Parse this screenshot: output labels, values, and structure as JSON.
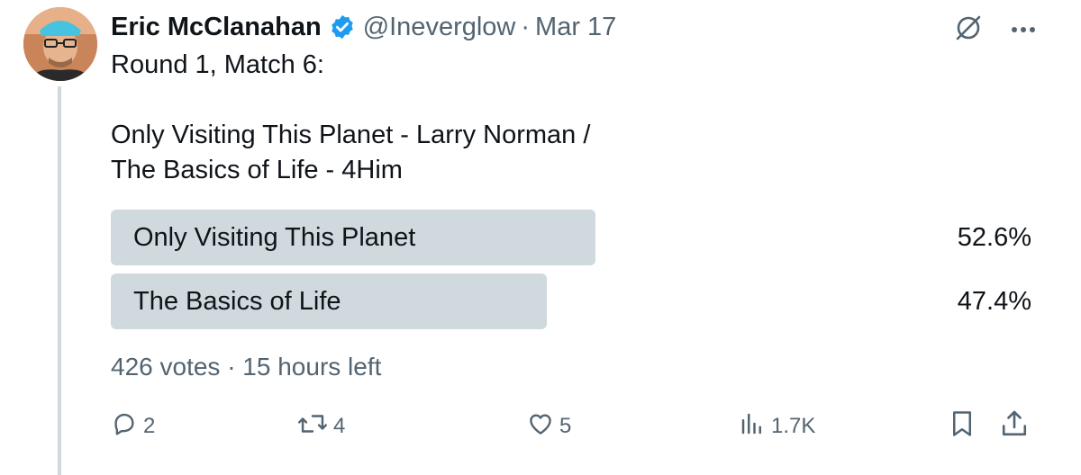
{
  "author": {
    "name": "Eric McClanahan",
    "handle": "@Ineverglow",
    "date": "Mar 17",
    "separator": "·"
  },
  "tweet": {
    "text": "Round 1, Match 6:\n\nOnly Visiting This Planet - Larry Norman /\nThe Basics of Life - 4Him"
  },
  "poll": {
    "options": [
      {
        "label": "Only Visiting This Planet",
        "percent_text": "52.6%",
        "fraction": 0.526
      },
      {
        "label": "The Basics of Life",
        "percent_text": "47.4%",
        "fraction": 0.474
      }
    ],
    "meta": "426 votes · 15 hours left"
  },
  "actions": {
    "replies": "2",
    "retweets": "4",
    "likes": "5",
    "views": "1.7K"
  },
  "colors": {
    "verified": "#1d9bf0",
    "poll_bar": "#cfd9de",
    "muted": "#536471"
  }
}
